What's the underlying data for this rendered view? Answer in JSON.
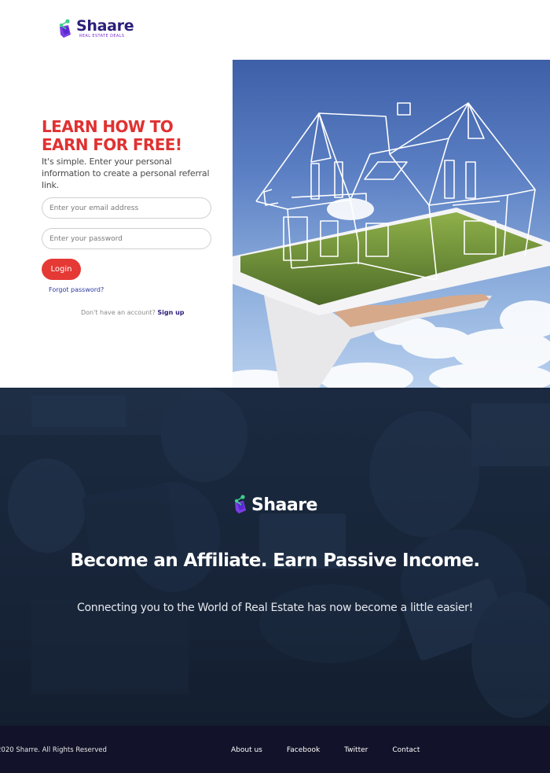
{
  "header": {
    "logo_word": "Shaare",
    "logo_tagline": "REAL ESTATE DEALS"
  },
  "login": {
    "headline_line1": "LEARN HOW TO",
    "headline_line2": "EARN FOR FREE!",
    "subtext": "It's simple. Enter your personal information to create a personal referral link.",
    "email_placeholder": "Enter your email address",
    "password_placeholder": "Enter your password",
    "login_label": "Login",
    "forgot_label": "Forgot password?",
    "signup_prompt": "Don't have an account?",
    "signup_label": "Sign up"
  },
  "banner": {
    "logo_word": "Shaare",
    "title": "Become an Affiliate. Earn Passive Income.",
    "subtitle": "Connecting you to the World of Real Estate has now become a little easier!"
  },
  "footer": {
    "copyright": "2020 Sharre. All Rights Reserved",
    "links": [
      "About us",
      "Facebook",
      "Twitter",
      "Contact"
    ]
  },
  "colors": {
    "brand_purple": "#2a1f7a",
    "accent_red": "#e53935",
    "logo_green": "#3ecf8e",
    "logo_violet": "#7b3fe4",
    "banner_bg": "#172438",
    "footer_bg": "#12122a"
  }
}
